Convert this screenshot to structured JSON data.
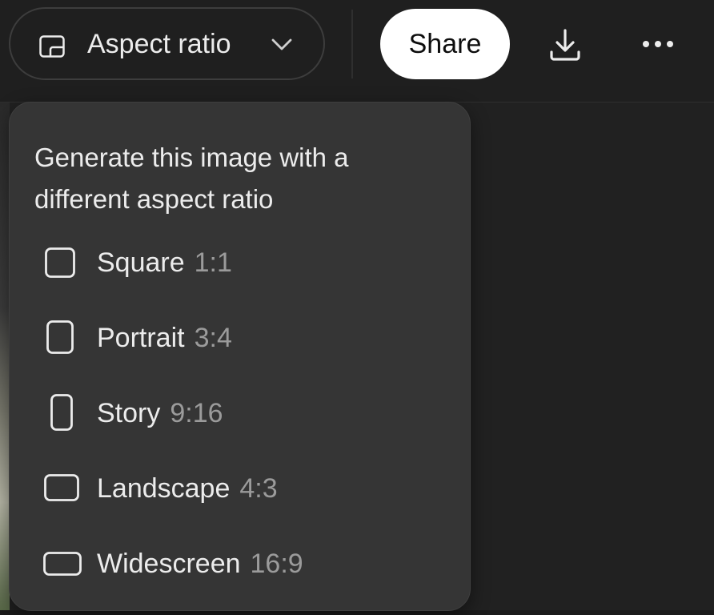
{
  "toolbar": {
    "aspect_button_label": "Aspect ratio",
    "share_label": "Share"
  },
  "popover": {
    "title": "Generate this image with a different aspect ratio",
    "options": [
      {
        "name": "Square",
        "ratio": "1:1",
        "icon": "square-shape-icon"
      },
      {
        "name": "Portrait",
        "ratio": "3:4",
        "icon": "portrait-shape-icon"
      },
      {
        "name": "Story",
        "ratio": "9:16",
        "icon": "story-shape-icon"
      },
      {
        "name": "Landscape",
        "ratio": "4:3",
        "icon": "landscape-shape-icon"
      },
      {
        "name": "Widescreen",
        "ratio": "16:9",
        "icon": "widescreen-shape-icon"
      }
    ]
  },
  "colors": {
    "background": "#212121",
    "popover": "#353535",
    "share_button": "#ffffff",
    "text": "#ececec",
    "muted_text": "#9b9b9b"
  }
}
